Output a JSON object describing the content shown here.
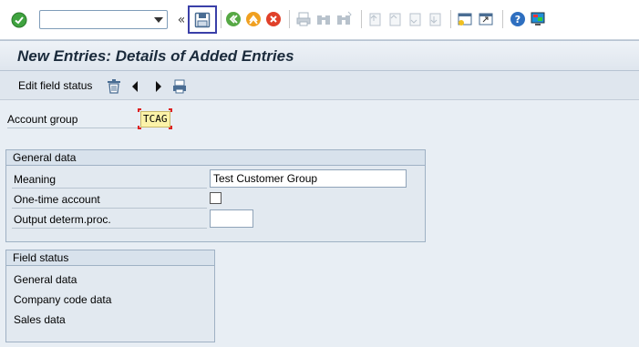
{
  "toolbar": {
    "command_field_value": "",
    "icons": [
      "enter-check",
      "command-dropdown",
      "expand",
      "save",
      "back",
      "exit",
      "cancel",
      "print",
      "find",
      "find-next",
      "first-page",
      "previous-page",
      "next-page",
      "last-page",
      "create-session",
      "shortcut",
      "help",
      "customize-layout"
    ]
  },
  "title": "New Entries: Details of Added Entries",
  "app_toolbar": {
    "edit_field_status": "Edit field status"
  },
  "account_group": {
    "label": "Account group",
    "value": "TCAG"
  },
  "general_data": {
    "heading": "General data",
    "meaning_label": "Meaning",
    "meaning_value": "Test Customer Group",
    "one_time_label": "One-time account",
    "one_time_checked": false,
    "output_label": "Output determ.proc.",
    "output_value": ""
  },
  "field_status": {
    "heading": "Field status",
    "items": [
      "General data",
      "Company code data",
      "Sales data"
    ]
  },
  "colors": {
    "highlight_border": "#3a3fa8",
    "title_text": "#1b2b3c",
    "field_yellow": "#fbf3a9"
  }
}
